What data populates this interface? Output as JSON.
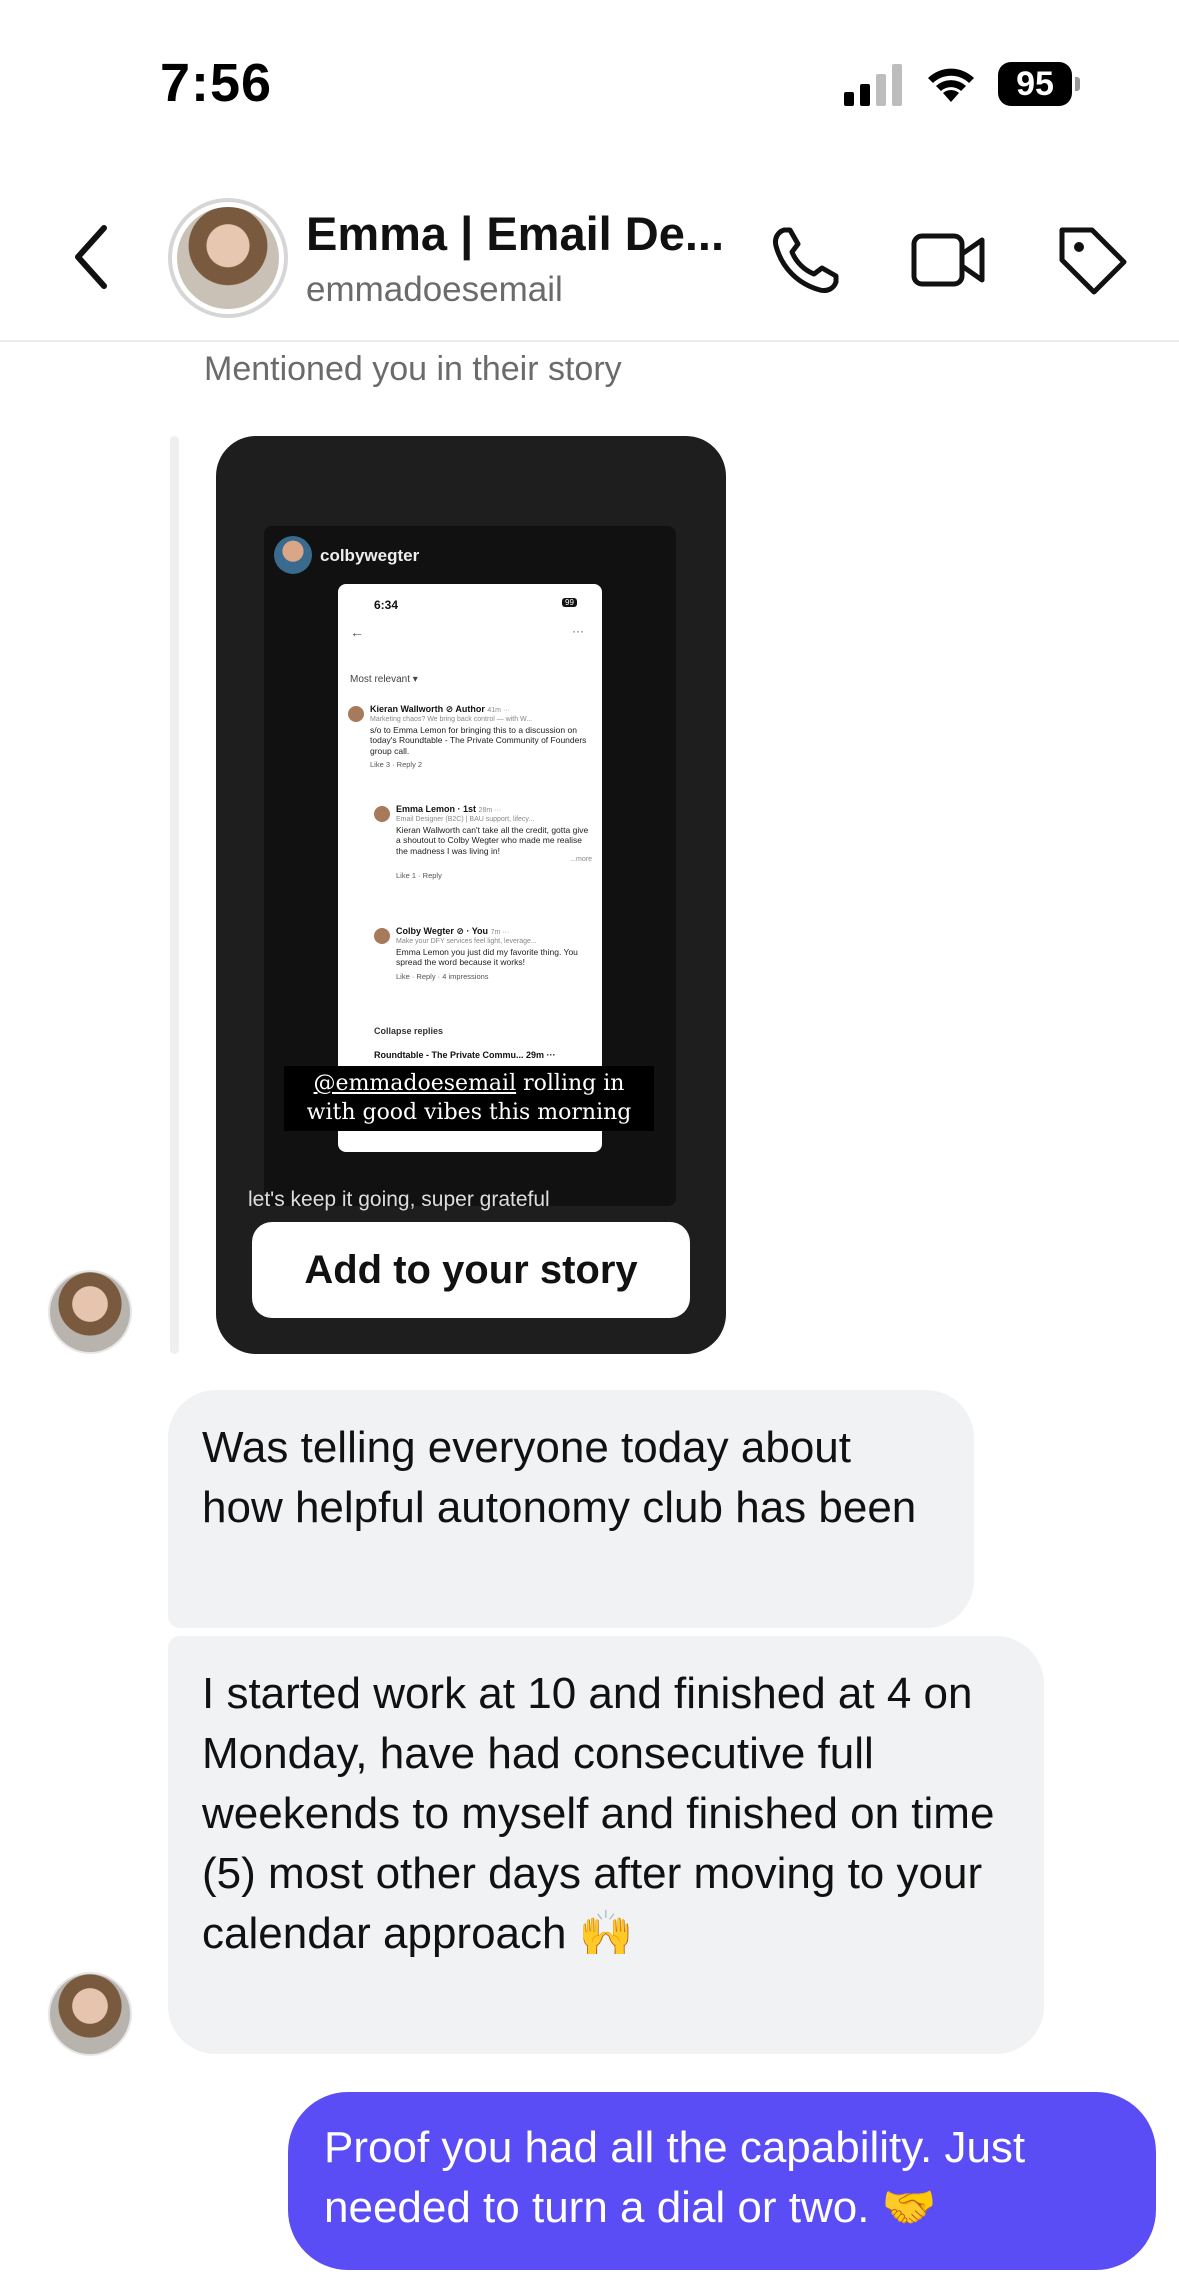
{
  "status_bar": {
    "time": "7:56",
    "battery": "95"
  },
  "header": {
    "name": "Emma | Email De...",
    "handle": "emmadoesemail"
  },
  "thread": {
    "mention_label": "Mentioned you in their story",
    "story": {
      "username": "colbywegter",
      "screenshot": {
        "time": "6:34",
        "battery": "99",
        "sort": "Most relevant ▾",
        "comments": [
          {
            "name": "Kieran Wallworth ⊘ Author",
            "meta": "41m ···",
            "subtitle": "Marketing chaos? We bring back control — with W...",
            "body": "s/o to Emma Lemon for bringing this to a discussion on today's Roundtable - The Private Community of Founders group call.",
            "actions": "Like  3 · Reply 2"
          },
          {
            "name": "Emma Lemon · 1st",
            "meta": "28m ···",
            "subtitle": "Email Designer (B2C) | BAU support, lifecy...",
            "body": "Kieran Wallworth can't take all the credit, gotta give a shoutout to Colby Wegter who made me realise the madness I was living in!",
            "more": "...more",
            "actions": "Like  1 · Reply"
          },
          {
            "name": "Colby Wegter ⊘ · You",
            "meta": "7m ···",
            "subtitle": "Make your DFY services feel light, leverage...",
            "body": "Emma Lemon you just did my favorite thing. You spread the word because it works!",
            "actions": "Like · Reply · 4 impressions"
          }
        ],
        "collapse": "Collapse replies",
        "roundtable": "Roundtable - The Private Commu...  29m ···"
      },
      "caption_mention": "@emmadoesemail",
      "caption_rest": " rolling in with good vibes this morning",
      "footer_text": "let's keep it going, super grateful",
      "add_button": "Add to your story"
    },
    "messages": [
      {
        "from": "them",
        "text": "Was telling everyone today about how helpful autonomy club has been"
      },
      {
        "from": "them",
        "text": "I started work at 10 and finished at 4 on Monday, have had consecutive full weekends to myself and finished on time (5) most other days after moving to your calendar approach 🙌"
      },
      {
        "from": "me",
        "text": "Proof you had all the capability. Just needed to turn a dial or two. 🤝"
      }
    ]
  },
  "colors": {
    "outgoing_bubble": "#5b4df5",
    "incoming_bubble": "#f1f2f4",
    "story_card": "#1e1e1e"
  }
}
